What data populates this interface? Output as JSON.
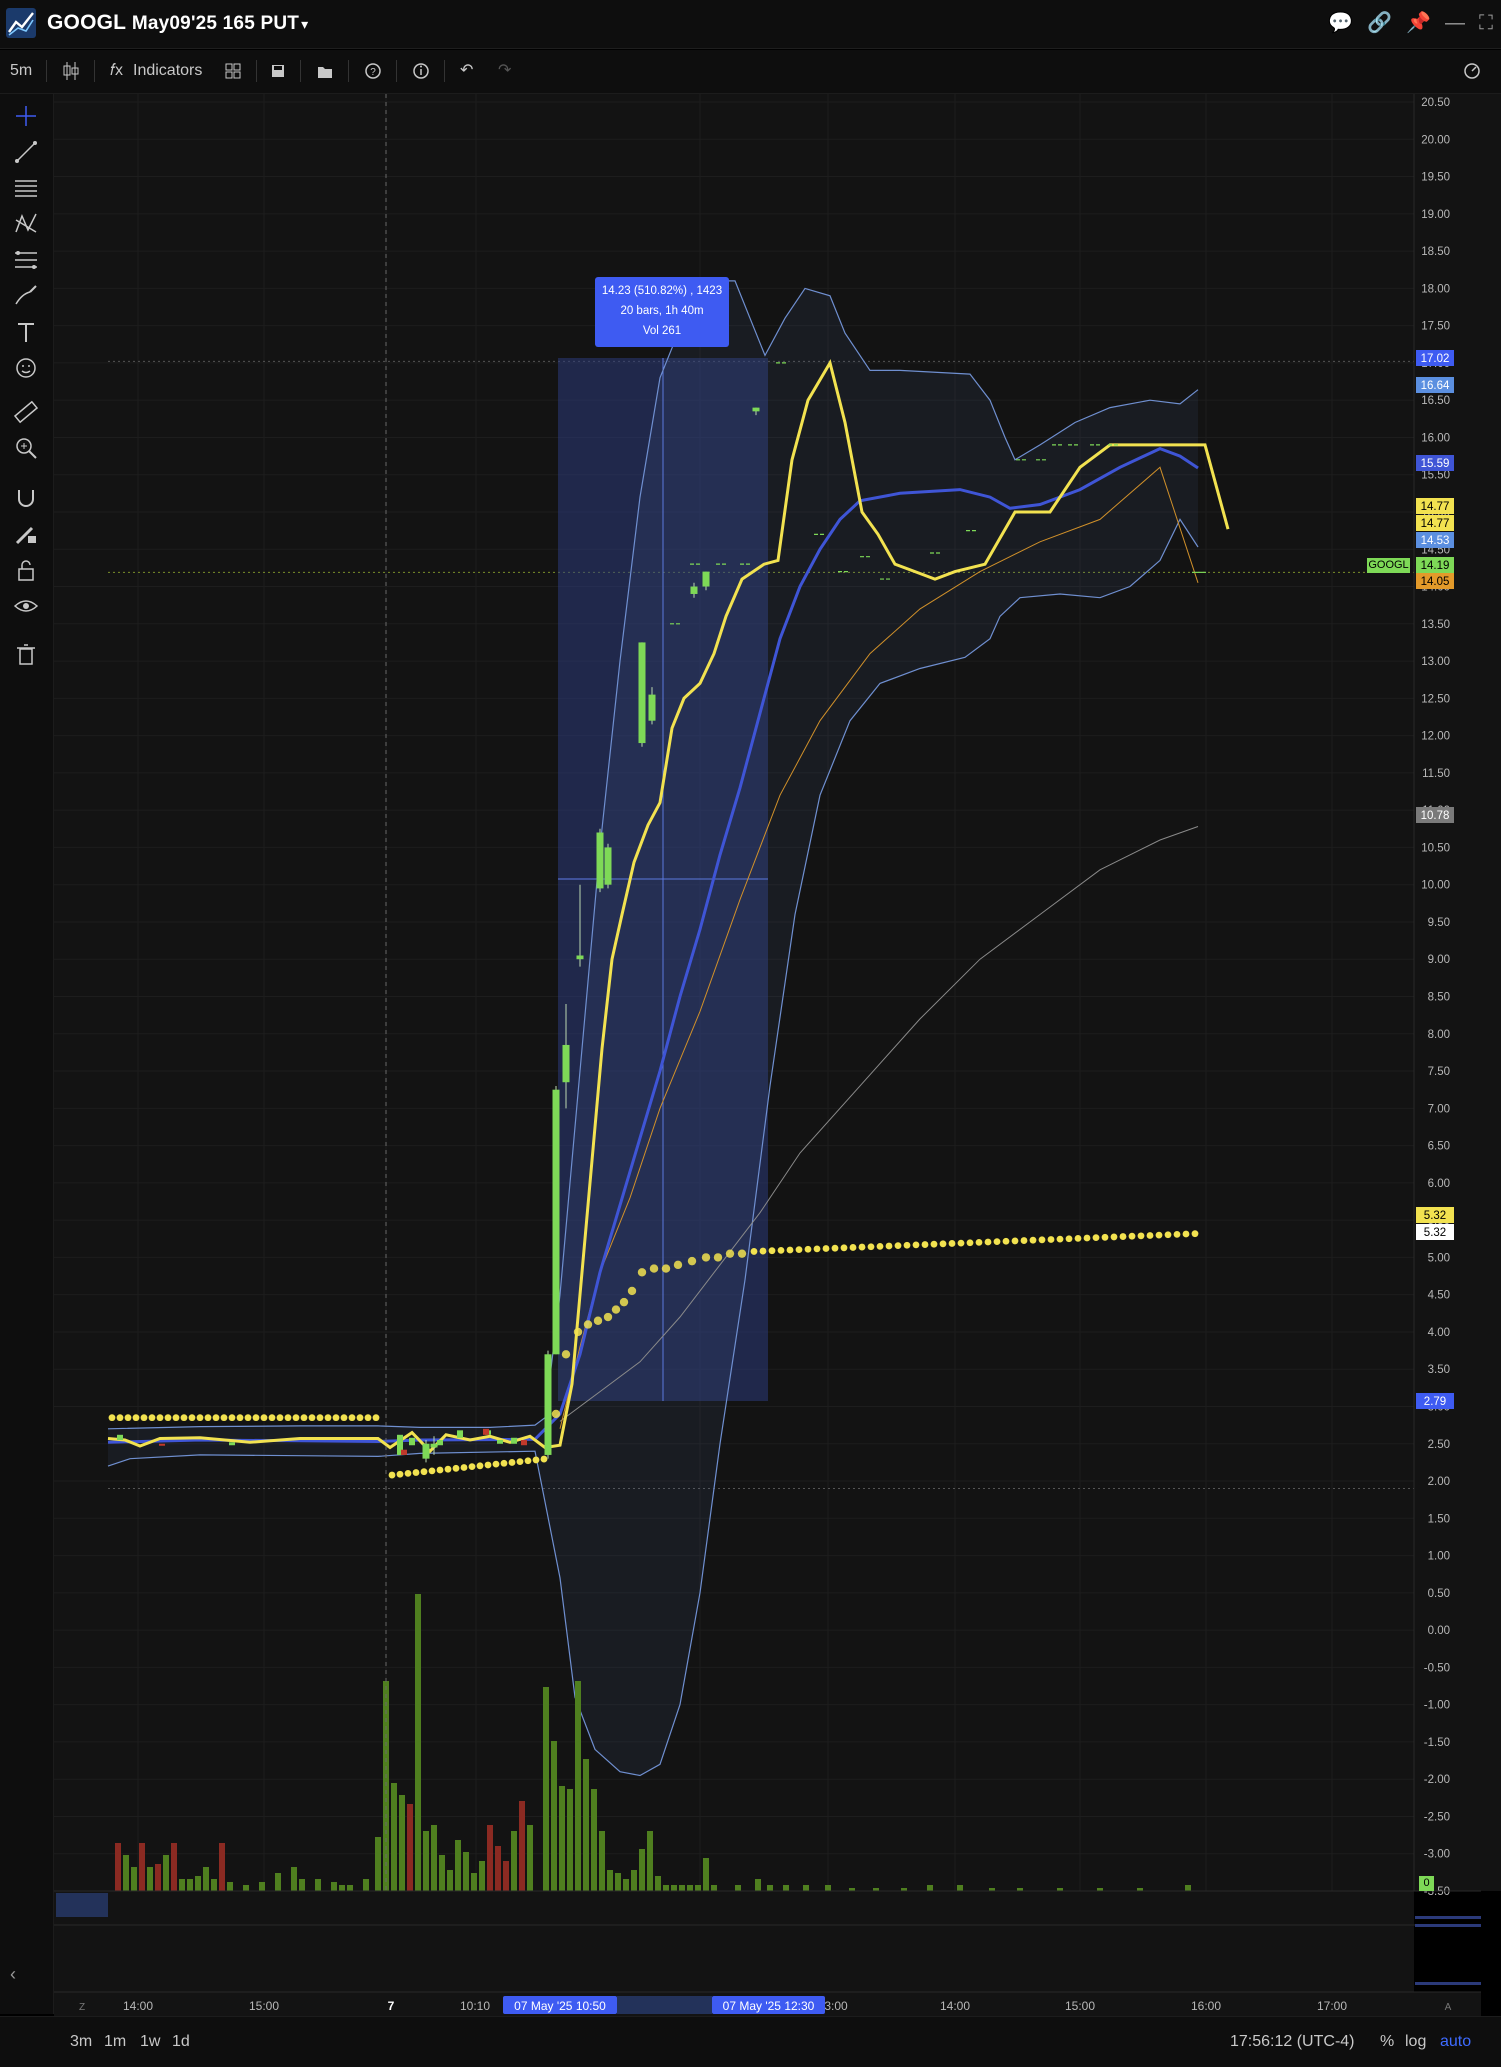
{
  "window": {
    "title_symbol": "GOOGL",
    "title_contract": "May09'25 165 PUT",
    "title_caret": "▾"
  },
  "toolbar": {
    "interval": "5m",
    "indicators_label": "Indicators"
  },
  "bottom_bar": {
    "ranges": [
      "3m",
      "1m",
      "1w",
      "1d"
    ],
    "clock": "17:56:12 (UTC-4)",
    "percent_label": "%",
    "log_label": "log",
    "auto_label": "auto"
  },
  "measure_tooltip": {
    "line1": "14.23 (510.82%) , 1423",
    "line2": "20 bars, 1h 40m",
    "line3": "Vol 261"
  },
  "symbol_tag": "GOOGL",
  "volume_zero_label": "0",
  "colors": {
    "background": "#131313",
    "candle_up": "#7ed957",
    "volume_up": "#4f7f1f",
    "volume_down": "#8b2a22",
    "fast_line": "#f2e250",
    "slow_line": "#3f55d6",
    "bands": "#6f8fd0",
    "orange_ma": "#d0902a",
    "grey_ma": "#8a8a8a",
    "dots": "#f2e250",
    "measure_box": "#2b3a7a",
    "accent_blue": "#3e5bf2"
  },
  "chart_data": {
    "type": "candlestick",
    "title": "GOOGL May09'25 165 PUT",
    "interval": "5m",
    "y_range": [
      -3.5,
      20.5
    ],
    "y_ticks": [
      "20.50",
      "20.00",
      "19.50",
      "19.00",
      "18.50",
      "18.00",
      "17.50",
      "17.00",
      "16.50",
      "16.00",
      "15.50",
      "15.00",
      "14.50",
      "14.00",
      "13.50",
      "13.00",
      "12.50",
      "12.00",
      "11.50",
      "11.00",
      "10.50",
      "10.00",
      "9.50",
      "9.00",
      "8.50",
      "8.00",
      "7.50",
      "7.00",
      "6.50",
      "6.00",
      "5.50",
      "5.00",
      "4.50",
      "4.00",
      "3.50",
      "3.00",
      "2.50",
      "2.00",
      "1.50",
      "1.00",
      "0.50",
      "0.00",
      "-0.50",
      "-1.00",
      "-1.50",
      "-2.00",
      "-2.50",
      "-3.00",
      "-3.50"
    ],
    "x_ticks": [
      "14:00",
      "15:00",
      "7",
      "10:10",
      "12:0",
      "3:00",
      "14:00",
      "15:00",
      "16:00",
      "17:00"
    ],
    "crosshair_x_labels": [
      "07 May '25   10:50",
      "07 May '25   12:30"
    ],
    "price_labels": [
      {
        "value": "17.02",
        "color": "#3e5bf2",
        "text_color": "#ffffff"
      },
      {
        "value": "16.64",
        "color": "#5b8fe0",
        "text_color": "#ffffff"
      },
      {
        "value": "15.59",
        "color": "#3f55d6",
        "text_color": "#ffffff"
      },
      {
        "value": "14.77",
        "color": "#f2e250",
        "text_color": "#000000"
      },
      {
        "value": "14.77",
        "color": "#f2e250",
        "text_color": "#000000"
      },
      {
        "value": "14.53",
        "color": "#5b8fe0",
        "text_color": "#ffffff"
      },
      {
        "value": "14.19",
        "color": "#7ed957",
        "text_color": "#000000"
      },
      {
        "value": "14.05",
        "color": "#e39a2a",
        "text_color": "#000000"
      },
      {
        "value": "10.78",
        "color": "#7a7a7a",
        "text_color": "#ffffff"
      },
      {
        "value": "5.32",
        "color": "#f2e250",
        "text_color": "#000000"
      },
      {
        "value": "5.32",
        "color": "#ffffff",
        "text_color": "#000000"
      },
      {
        "value": "2.79",
        "color": "#3e5bf2",
        "text_color": "#ffffff"
      }
    ],
    "candles": [
      {
        "t": "10:10",
        "o": 2.3,
        "h": 2.55,
        "l": 2.25,
        "c": 2.5
      },
      {
        "t": "10:15",
        "o": 2.5,
        "h": 2.6,
        "l": 2.35,
        "c": 2.45
      },
      {
        "t": "10:45",
        "o": 2.35,
        "h": 3.75,
        "l": 2.3,
        "c": 3.7
      },
      {
        "t": "10:50",
        "o": 3.7,
        "h": 7.3,
        "l": 3.7,
        "c": 7.25
      },
      {
        "t": "10:55",
        "o": 7.35,
        "h": 8.4,
        "l": 7.0,
        "c": 7.85
      },
      {
        "t": "11:00",
        "o": 9.0,
        "h": 10.0,
        "l": 8.9,
        "c": 9.05
      },
      {
        "t": "11:10",
        "o": 9.95,
        "h": 10.75,
        "l": 9.9,
        "c": 10.7
      },
      {
        "t": "11:15",
        "o": 10.0,
        "h": 10.55,
        "l": 9.95,
        "c": 10.5
      },
      {
        "t": "11:30",
        "o": 11.9,
        "h": 13.25,
        "l": 11.85,
        "c": 13.25
      },
      {
        "t": "11:35",
        "o": 12.2,
        "h": 12.65,
        "l": 12.15,
        "c": 12.55
      },
      {
        "t": "11:50",
        "o": 13.9,
        "h": 14.05,
        "l": 13.85,
        "c": 14.0
      },
      {
        "t": "11:55",
        "o": 14.0,
        "h": 14.2,
        "l": 13.95,
        "c": 14.2
      },
      {
        "t": "12:25",
        "o": 16.35,
        "h": 16.4,
        "l": 16.3,
        "c": 16.4
      }
    ],
    "fast_ma": [
      {
        "t": "13:45",
        "v": 2.57
      },
      {
        "t": "14:30",
        "v": 2.58
      },
      {
        "t": "15:00",
        "v": 2.57
      },
      {
        "t": "15:50",
        "v": 2.57
      },
      {
        "t": "10:00",
        "v": 2.59
      },
      {
        "t": "10:20",
        "v": 2.55
      },
      {
        "t": "10:40",
        "v": 2.58
      },
      {
        "t": "10:50",
        "v": 3.9
      },
      {
        "t": "11:00",
        "v": 6.5
      },
      {
        "t": "11:10",
        "v": 9.5
      },
      {
        "t": "11:20",
        "v": 11.0
      },
      {
        "t": "11:30",
        "v": 12.6
      },
      {
        "t": "11:40",
        "v": 13.5
      },
      {
        "t": "11:50",
        "v": 14.0
      },
      {
        "t": "12:00",
        "v": 14.4
      },
      {
        "t": "12:10",
        "v": 16.3
      },
      {
        "t": "12:20",
        "v": 17.0
      },
      {
        "t": "12:30",
        "v": 15.2
      },
      {
        "t": "12:40",
        "v": 14.6
      },
      {
        "t": "13:00",
        "v": 14.4
      },
      {
        "t": "13:20",
        "v": 14.5
      },
      {
        "t": "13:40",
        "v": 15.0
      },
      {
        "t": "14:00",
        "v": 15.4
      },
      {
        "t": "14:30",
        "v": 15.9
      },
      {
        "t": "15:30",
        "v": 15.9
      },
      {
        "t": "15:55",
        "v": 14.77
      }
    ],
    "slow_ma_last": 15.59,
    "upper_band_last": 16.64,
    "lower_band_last": 14.53,
    "orange_ma_last": 14.05,
    "grey_ma_last": 10.78,
    "dots_last": 5.32,
    "last_price": 14.19,
    "volume": [
      {
        "t": "13:50",
        "v": 8,
        "dir": "down"
      },
      {
        "t": "14:05",
        "v": 9,
        "dir": "down"
      },
      {
        "t": "14:15",
        "v": 8,
        "dir": "down"
      },
      {
        "t": "10:05",
        "v": 48,
        "dir": "up"
      },
      {
        "t": "10:10",
        "v": 86,
        "dir": "up"
      },
      {
        "t": "10:20",
        "v": 78,
        "dir": "up"
      },
      {
        "t": "10:35",
        "v": 19,
        "dir": "down"
      },
      {
        "t": "10:45",
        "v": 62,
        "dir": "up"
      },
      {
        "t": "10:50",
        "v": 87,
        "dir": "up"
      },
      {
        "t": "11:00",
        "v": 71,
        "dir": "up"
      },
      {
        "t": "11:35",
        "v": 51,
        "dir": "up"
      }
    ]
  }
}
